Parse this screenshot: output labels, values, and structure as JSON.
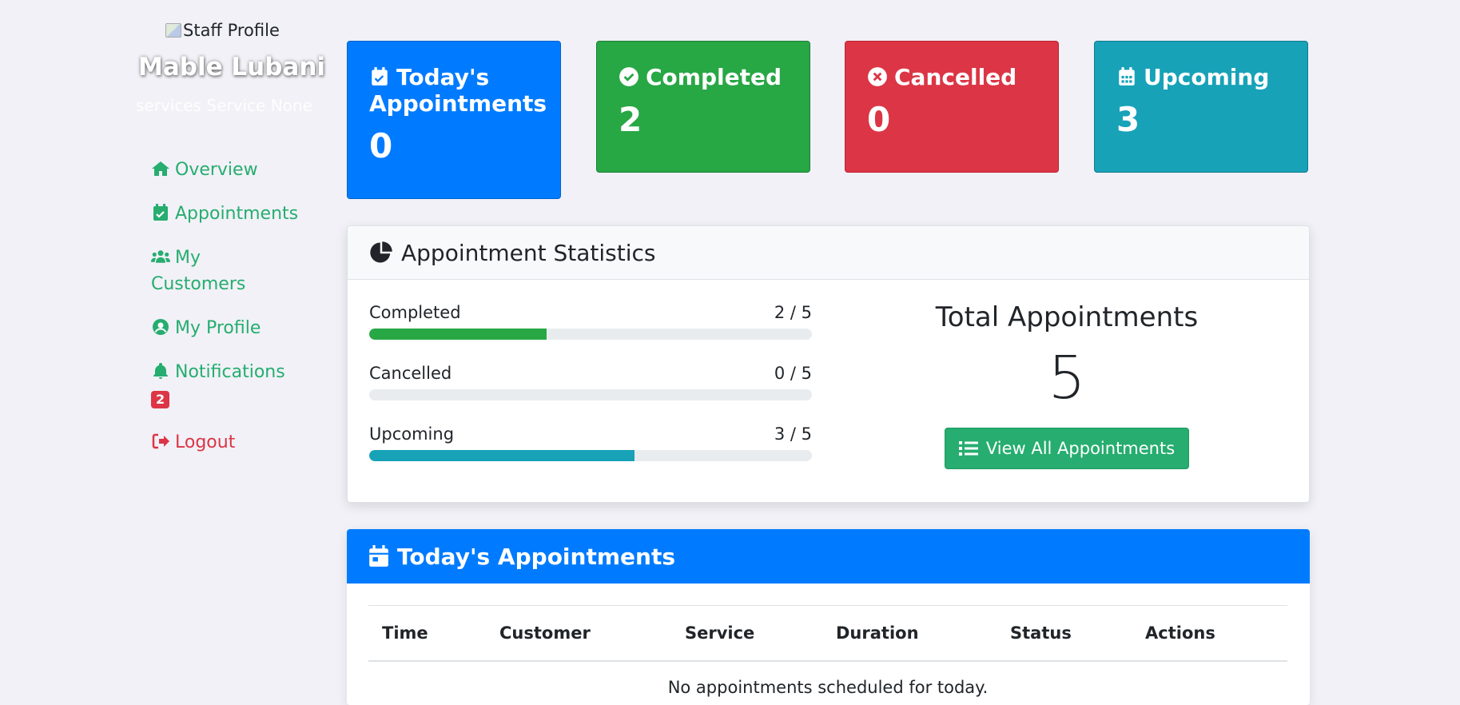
{
  "sidebar": {
    "profile_image_alt": "Staff Profile",
    "name": "Mable Lubani",
    "subtitle": "services Service None",
    "nav": {
      "overview": "Overview",
      "appointments": "Appointments",
      "my_customers_line1": "My",
      "my_customers_line2": "Customers",
      "my_profile": "My Profile",
      "notifications": "Notifications",
      "notifications_badge": "2",
      "logout": "Logout"
    }
  },
  "cards": {
    "today": {
      "title_line1": "Today's",
      "title_line2": "Appointments",
      "value": "0",
      "color": "#007bff"
    },
    "completed": {
      "title": "Completed",
      "value": "2",
      "color": "#28a745"
    },
    "cancelled": {
      "title": "Cancelled",
      "value": "0",
      "color": "#dc3545"
    },
    "upcoming": {
      "title": "Upcoming",
      "value": "3",
      "color": "#17a2b8"
    }
  },
  "stats": {
    "title": "Appointment Statistics",
    "bars": [
      {
        "label": "Completed",
        "count": "2 / 5",
        "fraction": 0.4,
        "color": "#28a745"
      },
      {
        "label": "Cancelled",
        "count": "0 / 5",
        "fraction": 0,
        "color": "#dc3545"
      },
      {
        "label": "Upcoming",
        "count": "3 / 5",
        "fraction": 0.6,
        "color": "#17a2b8"
      }
    ],
    "total_label": "Total Appointments",
    "total_value": "5",
    "view_all_label": "View All Appointments"
  },
  "today_table": {
    "title": "Today's Appointments",
    "columns": [
      "Time",
      "Customer",
      "Service",
      "Duration",
      "Status",
      "Actions"
    ],
    "empty_message": "No appointments scheduled for today."
  }
}
